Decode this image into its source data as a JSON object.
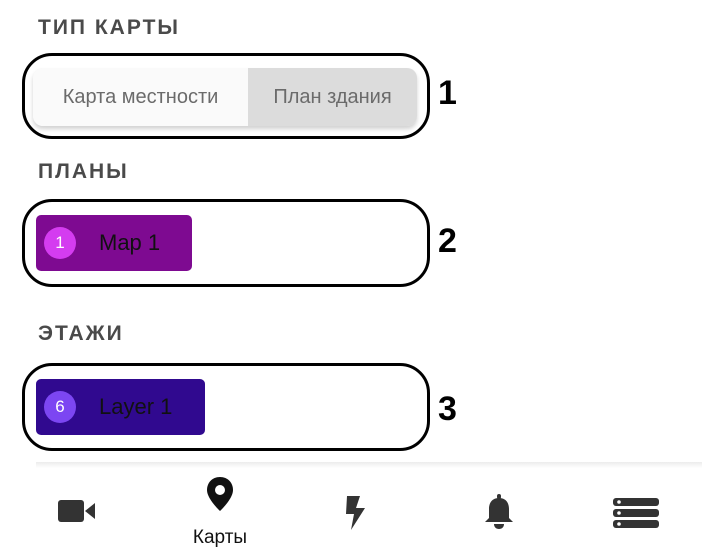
{
  "sections": {
    "map_type": "ТИП КАРТЫ",
    "plans": "ПЛАНЫ",
    "floors": "ЭТАЖИ"
  },
  "map_type_selector": {
    "options": [
      "Карта местности",
      "План здания"
    ],
    "selected": "План здания"
  },
  "plans": {
    "items": [
      {
        "number": "1",
        "name": "Map 1",
        "color": "#7e0a91",
        "badge_color": "#d43cf0"
      }
    ]
  },
  "floors": {
    "items": [
      {
        "number": "6",
        "name": "Layer 1",
        "color": "#30098f",
        "badge_color": "#7c46f2"
      }
    ]
  },
  "callouts": [
    "1",
    "2",
    "3"
  ],
  "bottom_nav": {
    "items": [
      {
        "icon": "video-camera-icon",
        "label": ""
      },
      {
        "icon": "map-pin-icon",
        "label": "Карты",
        "active": true
      },
      {
        "icon": "lightning-icon",
        "label": ""
      },
      {
        "icon": "bell-icon",
        "label": ""
      },
      {
        "icon": "menu-stack-icon",
        "label": ""
      }
    ]
  }
}
